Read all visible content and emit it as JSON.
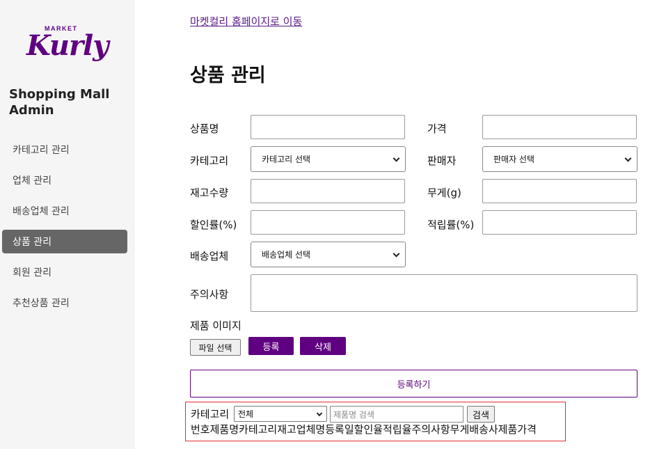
{
  "sidebar": {
    "logo_market": "MARKET",
    "logo_kurly": "Kurly",
    "title": "Shopping Mall Admin",
    "items": [
      {
        "label": "카테고리 관리"
      },
      {
        "label": "업체 관리"
      },
      {
        "label": "배송업체 관리"
      },
      {
        "label": "상품 관리"
      },
      {
        "label": "회원 관리"
      },
      {
        "label": "추천상품 관리"
      }
    ],
    "active": "상품 관리"
  },
  "home_link": "마켓컬리 홈페이지로 이동",
  "page_title": "상품 관리",
  "form": {
    "product_name_label": "상품명",
    "price_label": "가격",
    "category_label": "카테고리",
    "category_select": "카테고리 선택",
    "seller_label": "판매자",
    "seller_select": "판매자 선택",
    "stock_label": "재고수량",
    "weight_label": "무게(g)",
    "discount_label": "할인률(%)",
    "points_label": "적립률(%)",
    "delivery_label": "배송업체",
    "delivery_select": "배송업체 선택",
    "notes_label": "주의사항",
    "image_label": "제품 이미지",
    "file_button": "파일 선택",
    "register_button": "등록",
    "delete_button": "삭제",
    "submit_button": "등록하기"
  },
  "search": {
    "category_label": "카테고리",
    "category_value": "전체",
    "input_placeholder": "제품명 검색",
    "button": "검색"
  },
  "table": {
    "headers": [
      "번호",
      "제품명",
      "카테고리",
      "재고",
      "업체명",
      "등록일",
      "할인율",
      "적립율",
      "주의사항",
      "무게",
      "배송사",
      "제품가격"
    ]
  },
  "colors": {
    "brand": "#5f0080",
    "sidebar_active": "#666666",
    "search_border": "#e03030"
  }
}
